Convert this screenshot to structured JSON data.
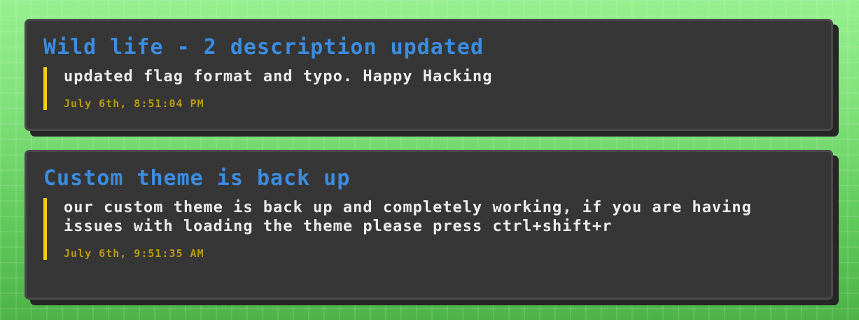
{
  "announcements": [
    {
      "title": "Wild life - 2 description updated",
      "body": "updated flag format and typo. Happy Hacking",
      "timestamp": "July 6th, 8:51:04 PM"
    },
    {
      "title": "Custom theme is back up",
      "body": "our custom theme is back up and completely working, if you are having issues with loading the theme please press ctrl+shift+r",
      "timestamp": "July 6th, 9:51:35 AM"
    }
  ],
  "colors": {
    "background": "#6fd66a",
    "card": "#363636",
    "title": "#3c8ce0",
    "accent_bar": "#f6cf13",
    "timestamp": "#b89a10"
  }
}
